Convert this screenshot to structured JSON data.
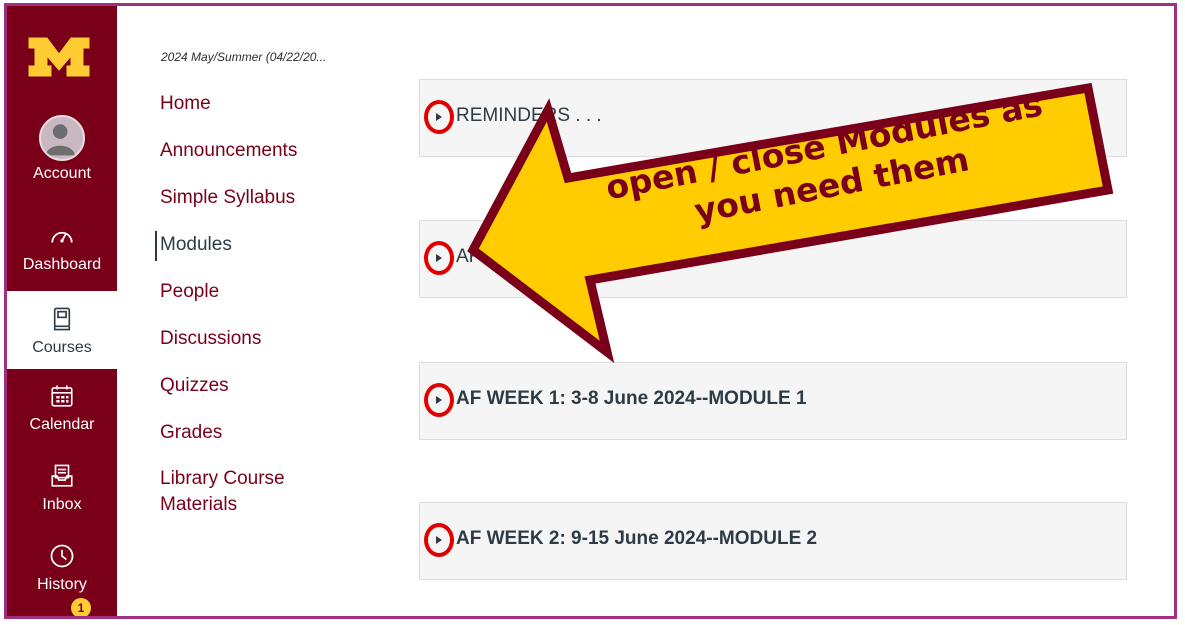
{
  "colors": {
    "maroon": "#7a0019",
    "gold": "#ffcc33",
    "annotation_red": "#e00000"
  },
  "global_nav": {
    "items": [
      {
        "label": "Account",
        "icon": "avatar-icon"
      },
      {
        "label": "Dashboard",
        "icon": "dashboard-icon"
      },
      {
        "label": "Courses",
        "icon": "courses-icon",
        "active": true
      },
      {
        "label": "Calendar",
        "icon": "calendar-icon"
      },
      {
        "label": "Inbox",
        "icon": "inbox-icon"
      },
      {
        "label": "History",
        "icon": "history-icon"
      }
    ],
    "badge": "1"
  },
  "course": {
    "title": "2024 May/Summer (04/22/20...",
    "nav": [
      "Home",
      "Announcements",
      "Simple Syllabus",
      "Modules",
      "People",
      "Discussions",
      "Quizzes",
      "Grades",
      "Library Course Materials"
    ]
  },
  "modules": [
    {
      "title": "REMINDERS . . ."
    },
    {
      "title": "AF"
    },
    {
      "title": "AF WEEK 1: 3-8 June 2024--MODULE 1"
    },
    {
      "title": "AF WEEK 2: 9-15 June 2024--MODULE 2"
    }
  ],
  "callout": {
    "line1": "open / close Modules as",
    "line2": "you need them"
  }
}
